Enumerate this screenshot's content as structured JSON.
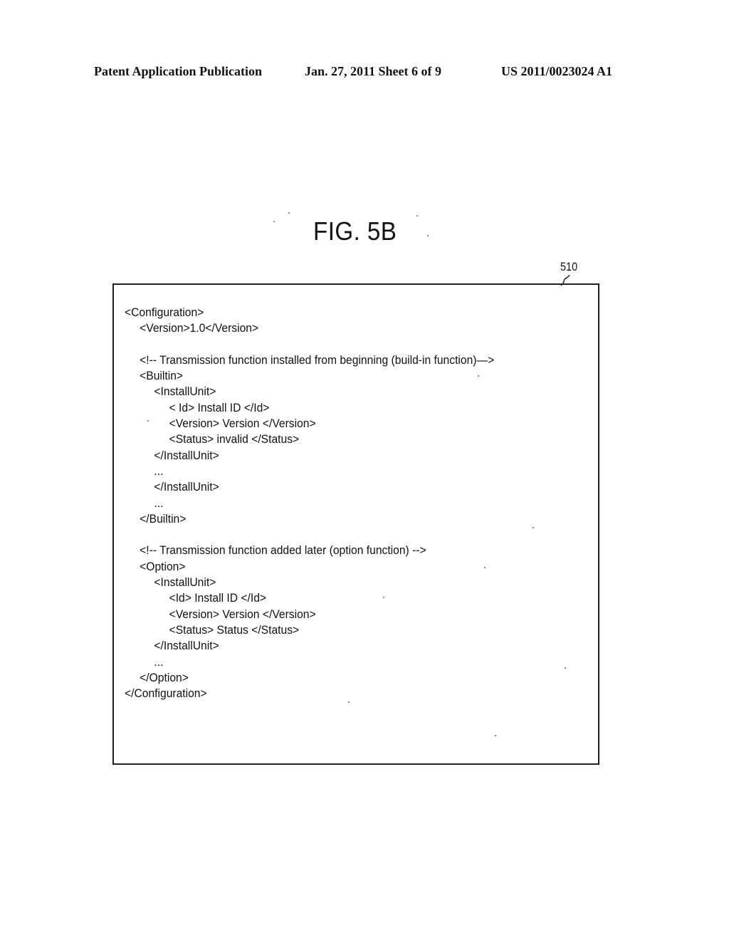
{
  "header": {
    "left": "Patent Application Publication",
    "middle": "Jan. 27, 2011  Sheet 6 of 9",
    "right": "US 2011/0023024 A1"
  },
  "figure": {
    "title": "FIG. 5B",
    "reference_numeral": "510"
  },
  "code_lines": [
    {
      "indent": 0,
      "text": "<Configuration>"
    },
    {
      "indent": 1,
      "text": "<Version>1.0</Version>"
    },
    {
      "indent": 0,
      "text": ""
    },
    {
      "indent": 1,
      "text": "<!-- Transmission function installed from beginning (build-in function)—>"
    },
    {
      "indent": 1,
      "text": "<Builtin>"
    },
    {
      "indent": 2,
      "text": "<InstallUnit>"
    },
    {
      "indent": 3,
      "text": "< Id> Install ID </Id>"
    },
    {
      "indent": 3,
      "text": "<Version> Version </Version>"
    },
    {
      "indent": 3,
      "text": "<Status> invalid </Status>"
    },
    {
      "indent": 2,
      "text": "</InstallUnit>"
    },
    {
      "indent": 2,
      "text": "..."
    },
    {
      "indent": 2,
      "text": "</InstallUnit>"
    },
    {
      "indent": 2,
      "text": "..."
    },
    {
      "indent": 1,
      "text": "</Builtin>"
    },
    {
      "indent": 0,
      "text": ""
    },
    {
      "indent": 1,
      "text": "<!-- Transmission function added later (option function) -->"
    },
    {
      "indent": 1,
      "text": "<Option>"
    },
    {
      "indent": 2,
      "text": "<InstallUnit>"
    },
    {
      "indent": 3,
      "text": "<Id> Install ID </Id>"
    },
    {
      "indent": 3,
      "text": "<Version> Version </Version>"
    },
    {
      "indent": 3,
      "text": "<Status> Status </Status>"
    },
    {
      "indent": 2,
      "text": "</InstallUnit>"
    },
    {
      "indent": 2,
      "text": "..."
    },
    {
      "indent": 1,
      "text": "</Option>"
    },
    {
      "indent": 0,
      "text": "</Configuration>"
    }
  ]
}
